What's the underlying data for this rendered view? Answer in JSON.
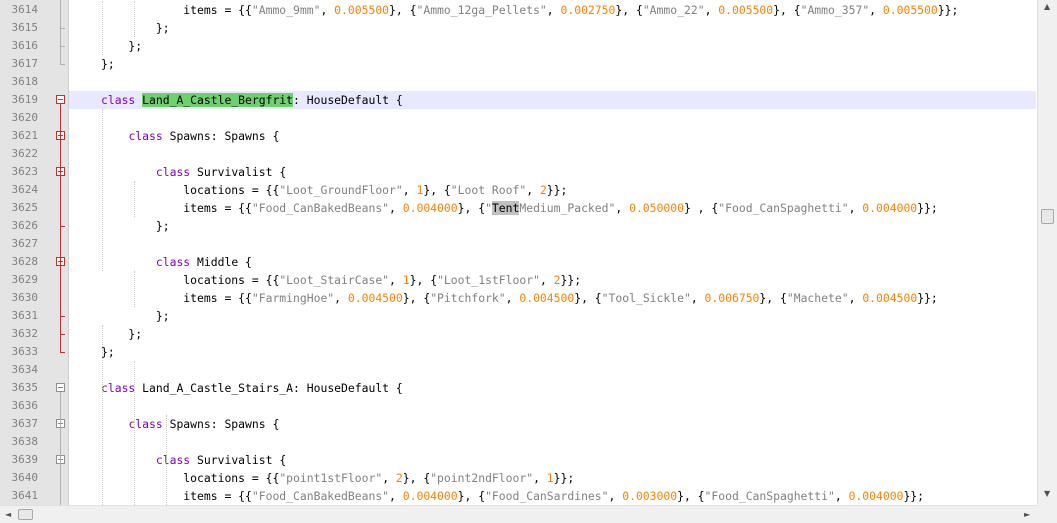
{
  "editor": {
    "lines": [
      {
        "n": "3614",
        "tokens": [
          [
            "t",
            "            items = {{"
          ],
          [
            "s",
            "\"Ammo_9mm\""
          ],
          [
            "t",
            ", "
          ],
          [
            "n",
            "0.005500"
          ],
          [
            "t",
            "}, {"
          ],
          [
            "s",
            "\"Ammo_12ga_Pellets\""
          ],
          [
            "t",
            ", "
          ],
          [
            "n",
            "0.002750"
          ],
          [
            "t",
            "}, {"
          ],
          [
            "s",
            "\"Ammo_22\""
          ],
          [
            "t",
            ", "
          ],
          [
            "n",
            "0.005500"
          ],
          [
            "t",
            "}, {"
          ],
          [
            "s",
            "\"Ammo_357\""
          ],
          [
            "t",
            ", "
          ],
          [
            "n",
            "0.005500"
          ],
          [
            "t",
            "}};"
          ]
        ]
      },
      {
        "n": "3615",
        "tokens": [
          [
            "t",
            "        };"
          ]
        ]
      },
      {
        "n": "3616",
        "tokens": [
          [
            "t",
            "    };"
          ]
        ]
      },
      {
        "n": "3617",
        "tokens": [
          [
            "t",
            "};"
          ]
        ]
      },
      {
        "n": "3618",
        "tokens": []
      },
      {
        "n": "3619",
        "active": true,
        "tokens": [
          [
            "k",
            "class"
          ],
          [
            "t",
            " "
          ],
          [
            "sel",
            "Land_A_Castle_Bergfrit"
          ],
          [
            "t",
            ": HouseDefault {"
          ]
        ]
      },
      {
        "n": "3620",
        "tokens": []
      },
      {
        "n": "3621",
        "tokens": [
          [
            "t",
            "    "
          ],
          [
            "k",
            "class"
          ],
          [
            "t",
            " Spawns: Spawns {"
          ]
        ]
      },
      {
        "n": "3622",
        "tokens": []
      },
      {
        "n": "3623",
        "tokens": [
          [
            "t",
            "        "
          ],
          [
            "k",
            "class"
          ],
          [
            "t",
            " Survivalist {"
          ]
        ]
      },
      {
        "n": "3624",
        "tokens": [
          [
            "t",
            "            locations = {{"
          ],
          [
            "s",
            "\"Loot_GroundFloor\""
          ],
          [
            "t",
            ", "
          ],
          [
            "n",
            "1"
          ],
          [
            "t",
            "}, {"
          ],
          [
            "s",
            "\"Loot Roof\""
          ],
          [
            "t",
            ", "
          ],
          [
            "n",
            "2"
          ],
          [
            "t",
            "}};"
          ]
        ]
      },
      {
        "n": "3625",
        "tokens": [
          [
            "t",
            "            items = {{"
          ],
          [
            "s",
            "\"Food_CanBakedBeans\""
          ],
          [
            "t",
            ", "
          ],
          [
            "n",
            "0.004000"
          ],
          [
            "t",
            "}, {"
          ],
          [
            "s",
            "\""
          ],
          [
            "hl",
            "Tent"
          ],
          [
            "s",
            "Medium_Packed\""
          ],
          [
            "t",
            ", "
          ],
          [
            "n",
            "0.050000"
          ],
          [
            "t",
            "} , {"
          ],
          [
            "s",
            "\"Food_CanSpaghetti\""
          ],
          [
            "t",
            ", "
          ],
          [
            "n",
            "0.004000"
          ],
          [
            "t",
            "}};"
          ]
        ]
      },
      {
        "n": "3626",
        "tokens": [
          [
            "t",
            "        };"
          ]
        ]
      },
      {
        "n": "3627",
        "tokens": []
      },
      {
        "n": "3628",
        "tokens": [
          [
            "t",
            "        "
          ],
          [
            "k",
            "class"
          ],
          [
            "t",
            " Middle {"
          ]
        ]
      },
      {
        "n": "3629",
        "tokens": [
          [
            "t",
            "            locations = {{"
          ],
          [
            "s",
            "\"Loot_StairCase\""
          ],
          [
            "t",
            ", "
          ],
          [
            "n",
            "1"
          ],
          [
            "t",
            "}, {"
          ],
          [
            "s",
            "\"Loot_1stFloor\""
          ],
          [
            "t",
            ", "
          ],
          [
            "n",
            "2"
          ],
          [
            "t",
            "}};"
          ]
        ]
      },
      {
        "n": "3630",
        "tokens": [
          [
            "t",
            "            items = {{"
          ],
          [
            "s",
            "\"FarmingHoe\""
          ],
          [
            "t",
            ", "
          ],
          [
            "n",
            "0.004500"
          ],
          [
            "t",
            "}, {"
          ],
          [
            "s",
            "\"Pitchfork\""
          ],
          [
            "t",
            ", "
          ],
          [
            "n",
            "0.004500"
          ],
          [
            "t",
            "}, {"
          ],
          [
            "s",
            "\"Tool_Sickle\""
          ],
          [
            "t",
            ", "
          ],
          [
            "n",
            "0.006750"
          ],
          [
            "t",
            "}, {"
          ],
          [
            "s",
            "\"Machete\""
          ],
          [
            "t",
            ", "
          ],
          [
            "n",
            "0.004500"
          ],
          [
            "t",
            "}};"
          ]
        ]
      },
      {
        "n": "3631",
        "tokens": [
          [
            "t",
            "        };"
          ]
        ]
      },
      {
        "n": "3632",
        "tokens": [
          [
            "t",
            "    };"
          ]
        ]
      },
      {
        "n": "3633",
        "tokens": [
          [
            "t",
            "};"
          ]
        ]
      },
      {
        "n": "3634",
        "tokens": []
      },
      {
        "n": "3635",
        "tokens": [
          [
            "k",
            "class"
          ],
          [
            "t",
            " Land_A_Castle_Stairs_A: HouseDefault {"
          ]
        ]
      },
      {
        "n": "3636",
        "tokens": []
      },
      {
        "n": "3637",
        "tokens": [
          [
            "t",
            "    "
          ],
          [
            "k",
            "class"
          ],
          [
            "t",
            " Spawns: Spawns {"
          ]
        ]
      },
      {
        "n": "3638",
        "tokens": []
      },
      {
        "n": "3639",
        "tokens": [
          [
            "t",
            "        "
          ],
          [
            "k",
            "class"
          ],
          [
            "t",
            " Survivalist {"
          ]
        ]
      },
      {
        "n": "3640",
        "tokens": [
          [
            "t",
            "            locations = {{"
          ],
          [
            "s",
            "\"point1stFloor\""
          ],
          [
            "t",
            ", "
          ],
          [
            "n",
            "2"
          ],
          [
            "t",
            "}, {"
          ],
          [
            "s",
            "\"point2ndFloor\""
          ],
          [
            "t",
            ", "
          ],
          [
            "n",
            "1"
          ],
          [
            "t",
            "}};"
          ]
        ]
      },
      {
        "n": "3641",
        "tokens": [
          [
            "t",
            "            items = {{"
          ],
          [
            "s",
            "\"Food_CanBakedBeans\""
          ],
          [
            "t",
            ", "
          ],
          [
            "n",
            "0.004000"
          ],
          [
            "t",
            "}, {"
          ],
          [
            "s",
            "\"Food_CanSardines\""
          ],
          [
            "t",
            ", "
          ],
          [
            "n",
            "0.003000"
          ],
          [
            "t",
            "}, {"
          ],
          [
            "s",
            "\"Food_CanSpaghetti\""
          ],
          [
            "t",
            ", "
          ],
          [
            "n",
            "0.004000"
          ],
          [
            "t",
            "}};"
          ]
        ]
      }
    ]
  },
  "colors": {
    "keyword": "#8000c0",
    "string": "#808080",
    "number": "#ff8000",
    "selection": "#6ed06e",
    "active_line": "#e8e8ff"
  },
  "scrollbars": {
    "left_arrow": "◄",
    "right_arrow": "►",
    "up_arrow": "▲",
    "down_arrow": "▼"
  }
}
